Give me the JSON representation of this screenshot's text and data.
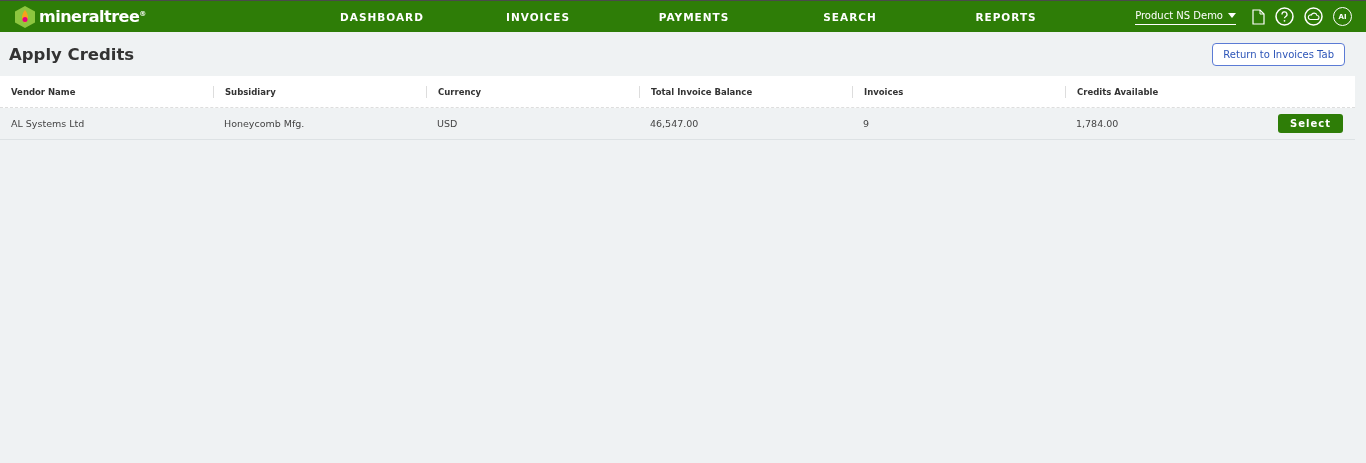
{
  "brand": {
    "name": "mineraltree",
    "mark": "®"
  },
  "nav": [
    "DASHBOARD",
    "INVOICES",
    "PAYMENTS",
    "SEARCH",
    "REPORTS"
  ],
  "account": {
    "label": "Product NS Demo"
  },
  "user": {
    "initials": "AI"
  },
  "page": {
    "title": "Apply Credits",
    "return_button": "Return to Invoices Tab"
  },
  "table": {
    "columns": [
      "Vendor Name",
      "Subsidiary",
      "Currency",
      "Total Invoice Balance",
      "Invoices",
      "Credits Available"
    ],
    "rows": [
      {
        "cells": [
          "AL Systems Ltd",
          "Honeycomb Mfg.",
          "USD",
          "46,547.00",
          "9",
          "1,784.00"
        ],
        "action": "Select"
      }
    ]
  }
}
